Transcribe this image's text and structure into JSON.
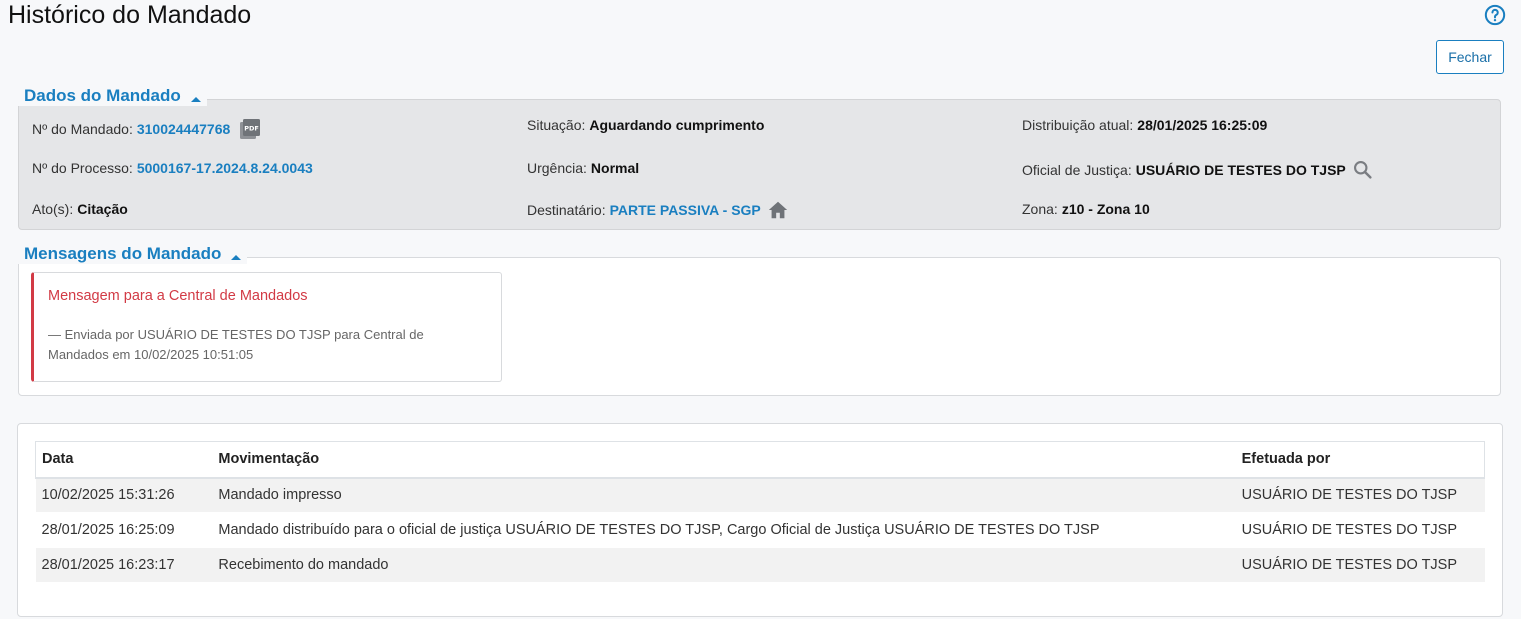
{
  "page": {
    "title": "Histórico do Mandado",
    "close_label": "Fechar"
  },
  "dados": {
    "section_title": "Dados do Mandado",
    "mandado_label": "Nº do Mandado:",
    "mandado_value": "310024447768",
    "processo_label": "Nº do Processo:",
    "processo_value": "5000167-17.2024.8.24.0043",
    "atos_label": "Ato(s):",
    "atos_value": "Citação",
    "situacao_label": "Situação:",
    "situacao_value": "Aguardando cumprimento",
    "urgencia_label": "Urgência:",
    "urgencia_value": "Normal",
    "destinatario_label": "Destinatário:",
    "destinatario_value": "PARTE PASSIVA - SGP",
    "distribuicao_label": "Distribuição atual:",
    "distribuicao_value": "28/01/2025 16:25:09",
    "oficial_label": "Oficial de Justiça:",
    "oficial_value": "USUÁRIO DE TESTES DO TJSP",
    "zona_label": "Zona:",
    "zona_value": "z10 - Zona 10"
  },
  "mensagens": {
    "section_title": "Mensagens do Mandado",
    "items": [
      {
        "title": "Mensagem para a Central de Mandados",
        "body": "—  Enviada por USUÁRIO DE TESTES DO TJSP para Central de Mandados em 10/02/2025 10:51:05"
      }
    ]
  },
  "historico": {
    "columns": [
      "Data",
      "Movimentação",
      "Efetuada por"
    ],
    "rows": [
      [
        "10/02/2025 15:31:26",
        "Mandado impresso",
        "USUÁRIO DE TESTES DO TJSP"
      ],
      [
        "28/01/2025 16:25:09",
        "Mandado distribuído para o oficial de justiça USUÁRIO DE TESTES DO TJSP, Cargo Oficial de Justiça USUÁRIO DE TESTES DO TJSP",
        "USUÁRIO DE TESTES DO TJSP"
      ],
      [
        "28/01/2025 16:23:17",
        "Recebimento do mandado",
        "USUÁRIO DE TESTES DO TJSP"
      ]
    ]
  },
  "icons": {
    "help": "help-circle-icon",
    "pdf": "pdf-file-icon",
    "search": "search-icon",
    "home": "home-icon",
    "collapse": "caret-up-icon"
  },
  "colors": {
    "accent": "#1a7fc0",
    "message_accent": "#d23a45",
    "panel_bg": "#e5e6e8"
  }
}
